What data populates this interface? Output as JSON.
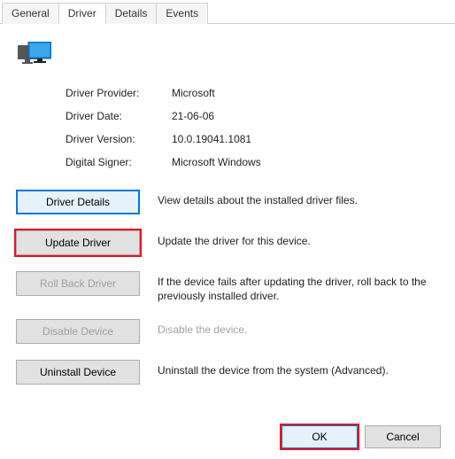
{
  "tabs": {
    "general": "General",
    "driver": "Driver",
    "details": "Details",
    "events": "Events"
  },
  "info": {
    "provider_label": "Driver Provider:",
    "provider_value": "Microsoft",
    "date_label": "Driver Date:",
    "date_value": "21-06-06",
    "version_label": "Driver Version:",
    "version_value": "10.0.19041.1081",
    "signer_label": "Digital Signer:",
    "signer_value": "Microsoft Windows"
  },
  "buttons": {
    "details": "Driver Details",
    "details_desc": "View details about the installed driver files.",
    "update": "Update Driver",
    "update_desc": "Update the driver for this device.",
    "rollback": "Roll Back Driver",
    "rollback_desc": "If the device fails after updating the driver, roll back to the previously installed driver.",
    "disable": "Disable Device",
    "disable_desc": "Disable the device.",
    "uninstall": "Uninstall Device",
    "uninstall_desc": "Uninstall the device from the system (Advanced)."
  },
  "footer": {
    "ok": "OK",
    "cancel": "Cancel"
  }
}
